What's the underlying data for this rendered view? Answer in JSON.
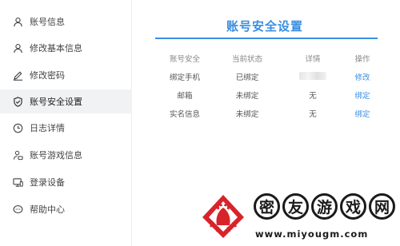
{
  "sidebar": {
    "items": [
      {
        "label": "账号信息",
        "icon": "user-icon"
      },
      {
        "label": "修改基本信息",
        "icon": "user-edit-icon"
      },
      {
        "label": "修改密码",
        "icon": "pencil-icon"
      },
      {
        "label": "账号安全设置",
        "icon": "shield-icon",
        "active": true
      },
      {
        "label": "日志详情",
        "icon": "clock-icon"
      },
      {
        "label": "账号游戏信息",
        "icon": "gamepad-icon"
      },
      {
        "label": "登录设备",
        "icon": "monitor-icon"
      },
      {
        "label": "帮助中心",
        "icon": "chat-icon"
      }
    ]
  },
  "main": {
    "title": "账号安全设置",
    "columns": [
      "账号安全",
      "当前状态",
      "详情",
      "操作"
    ],
    "rows": [
      {
        "name": "绑定手机",
        "status": "已绑定",
        "detail": "",
        "action": "修改"
      },
      {
        "name": "邮箱",
        "status": "未绑定",
        "detail": "无",
        "action": "绑定"
      },
      {
        "name": "实名信息",
        "status": "未绑定",
        "detail": "无",
        "action": "绑定"
      }
    ]
  },
  "watermark": {
    "chars": [
      "密",
      "友",
      "游",
      "戏",
      "网"
    ],
    "url": "www.miyougm.com"
  },
  "colors": {
    "accent": "#3a8ee0",
    "active_bg": "#f1f2f4",
    "logo_red": "#d9232b"
  }
}
